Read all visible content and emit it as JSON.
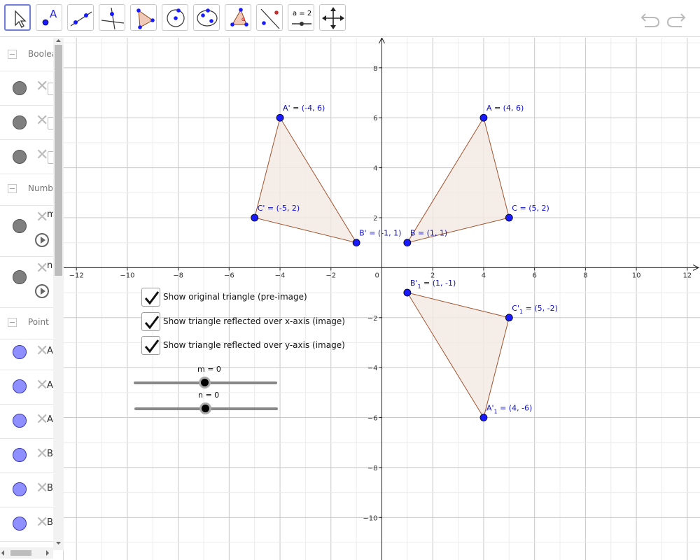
{
  "toolbar": {
    "tools": [
      {
        "name": "move-tool-button",
        "icon": "cursor-arrow-icon"
      },
      {
        "name": "point-tool-button",
        "icon": "point-icon",
        "label": "A"
      },
      {
        "name": "line-tool-button",
        "icon": "line-icon"
      },
      {
        "name": "perpendicular-tool-button",
        "icon": "perpendicular-line-icon"
      },
      {
        "name": "polygon-tool-button",
        "icon": "polygon-icon"
      },
      {
        "name": "circle-tool-button",
        "icon": "circle-icon"
      },
      {
        "name": "ellipse-tool-button",
        "icon": "ellipse-icon"
      },
      {
        "name": "angle-tool-button",
        "icon": "angle-icon"
      },
      {
        "name": "reflect-tool-button",
        "icon": "reflect-icon"
      },
      {
        "name": "slider-tool-button",
        "icon": "slider-icon",
        "label": "a = 2"
      },
      {
        "name": "move-view-tool-button",
        "icon": "move-graphics-icon"
      }
    ],
    "undo_icon": "undo-icon",
    "redo_icon": "redo-icon"
  },
  "algebra": {
    "groups": {
      "boolean": "Boolea",
      "number": "Numbe",
      "point": "Point"
    },
    "number_rows": [
      "m",
      "n"
    ],
    "point_rows": [
      "A",
      "A",
      "A",
      "B",
      "B",
      "B"
    ]
  },
  "graphics": {
    "checkboxes": [
      {
        "label": "Show original triangle (pre-image)",
        "checked": true
      },
      {
        "label": "Show triangle reflected over x-axis (image)",
        "checked": true
      },
      {
        "label": "Show triangle reflected over y-axis (image)",
        "checked": true
      }
    ],
    "sliders": [
      {
        "label": "m = 0",
        "value": 0,
        "min": -5,
        "max": 5
      },
      {
        "label": "n = 0",
        "value": 0,
        "min": -5,
        "max": 5
      }
    ]
  },
  "chart_data": {
    "type": "scatter",
    "xlim": [
      -12.5,
      12.5
    ],
    "ylim": [
      -11.7,
      9.2
    ],
    "grid": true,
    "x_ticks": [
      -12,
      -10,
      -8,
      -6,
      -4,
      -2,
      2,
      4,
      6,
      8,
      10,
      12
    ],
    "y_ticks": [
      8,
      6,
      4,
      2,
      -2,
      -4,
      -6,
      -8,
      -10
    ],
    "origin_label": "0",
    "colors": {
      "point": "#1a1aff",
      "edge": "#a0522d",
      "fill": "#f3e8e2",
      "label": "#1010cc"
    },
    "points": [
      {
        "id": "A",
        "label": "A = (4, 6)",
        "x": 4,
        "y": 6
      },
      {
        "id": "B",
        "label": "B = (1, 1)",
        "x": 1,
        "y": 1
      },
      {
        "id": "C",
        "label": "C = (5, 2)",
        "x": 5,
        "y": 2
      },
      {
        "id": "A'",
        "label": "A' = (-4, 6)",
        "x": -4,
        "y": 6
      },
      {
        "id": "B'",
        "label": "B' = (-1, 1)",
        "x": -1,
        "y": 1
      },
      {
        "id": "C'",
        "label": "C' = (-5, 2)",
        "x": -5,
        "y": 2
      },
      {
        "id": "A'1",
        "label": "A'",
        "sub": "1",
        "suffix": " = (4, -6)",
        "x": 4,
        "y": -6
      },
      {
        "id": "B'1",
        "label": "B'",
        "sub": "1",
        "suffix": " = (1, -1)",
        "x": 1,
        "y": -1
      },
      {
        "id": "C'1",
        "label": "C'",
        "sub": "1",
        "suffix": " = (5, -2)",
        "x": 5,
        "y": -2
      }
    ],
    "triangles": [
      [
        "A",
        "B",
        "C"
      ],
      [
        "A'",
        "B'",
        "C'"
      ],
      [
        "A'1",
        "B'1",
        "C'1"
      ]
    ]
  }
}
